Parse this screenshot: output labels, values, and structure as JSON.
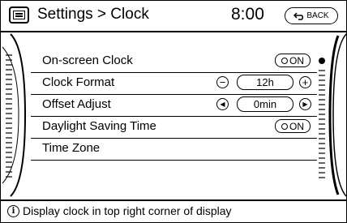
{
  "header": {
    "title": "Settings > Clock",
    "time": "8:00",
    "back_label": "BACK"
  },
  "rows": [
    {
      "label": "On-screen Clock",
      "control": "toggle",
      "value": "ON"
    },
    {
      "label": "Clock Format",
      "control": "stepper",
      "value": "12h",
      "dec_symbol": "−",
      "inc_symbol": "+"
    },
    {
      "label": "Offset Adjust",
      "control": "stepper",
      "value": "0min",
      "dec_symbol": "◀",
      "inc_symbol": "▶"
    },
    {
      "label": "Daylight Saving Time",
      "control": "toggle",
      "value": "ON"
    },
    {
      "label": "Time Zone",
      "control": "none"
    }
  ],
  "footer": {
    "icon": "info-icon",
    "text": "Display clock in top right corner of display"
  }
}
